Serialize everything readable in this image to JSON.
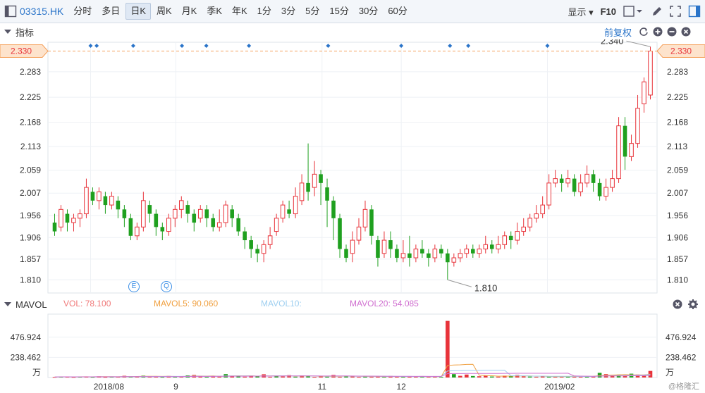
{
  "toolbar": {
    "ticker": "03315.HK",
    "periods": [
      "分时",
      "多日",
      "日K",
      "周K",
      "月K",
      "季K",
      "年K",
      "1分",
      "3分",
      "5分",
      "15分",
      "30分",
      "60分"
    ],
    "active_period": "日K",
    "display_label": "显示",
    "f10_label": "F10"
  },
  "indicator_bar": {
    "title": "指标",
    "adjust_label": "前复权"
  },
  "colors": {
    "up": "#e8333a",
    "down": "#1fa01f",
    "accent": "#2a74c9",
    "price_line": "#f5a05a"
  },
  "price_panel": {
    "current_price_left": "2.330",
    "current_price_right": "2.330",
    "high_label": "2.340",
    "low_label": "1.810",
    "event_icons": [
      "E",
      "Q"
    ]
  },
  "volume_panel": {
    "title": "MAVOL",
    "vol_label": "VOL:",
    "vol_value": "78.100",
    "mavol5_label": "MAVOL5:",
    "mavol5_value": "90.060",
    "mavol10_label": "MAVOL10:",
    "mavol10_value": "",
    "mavol20_label": "MAVOL20:",
    "mavol20_value": "54.085",
    "unit": "万"
  },
  "watermark": "@格隆汇",
  "chart_data": {
    "type": "candlestick",
    "y_ticks": [
      "2.283",
      "2.225",
      "2.168",
      "2.113",
      "2.059",
      "2.007",
      "1.956",
      "1.906",
      "1.857",
      "1.810"
    ],
    "ylim": [
      1.78,
      2.35
    ],
    "x_ticks": [
      "2018/08",
      "9",
      "11",
      "12",
      "2019/02"
    ],
    "volume_ticks": [
      "476.924",
      "238.462"
    ],
    "volume_ylim": [
      0,
      750
    ],
    "candles": [
      [
        1.94,
        1.92,
        1.96,
        1.91
      ],
      [
        1.93,
        1.97,
        1.98,
        1.92
      ],
      [
        1.96,
        1.94,
        1.97,
        1.92
      ],
      [
        1.94,
        1.95,
        1.96,
        1.92
      ],
      [
        1.95,
        1.96,
        1.97,
        1.93
      ],
      [
        1.96,
        2.02,
        2.04,
        1.95
      ],
      [
        2.01,
        1.99,
        2.02,
        1.98
      ],
      [
        1.99,
        2.01,
        2.02,
        1.97
      ],
      [
        2.0,
        1.98,
        2.01,
        1.96
      ],
      [
        1.98,
        2.0,
        2.01,
        1.97
      ],
      [
        1.99,
        1.97,
        2.0,
        1.95
      ],
      [
        1.97,
        1.95,
        1.98,
        1.93
      ],
      [
        1.95,
        1.91,
        1.96,
        1.9
      ],
      [
        1.91,
        1.93,
        1.94,
        1.9
      ],
      [
        1.93,
        1.99,
        2.01,
        1.92
      ],
      [
        1.98,
        1.96,
        1.99,
        1.94
      ],
      [
        1.96,
        1.93,
        1.97,
        1.91
      ],
      [
        1.93,
        1.92,
        1.94,
        1.9
      ],
      [
        1.92,
        1.95,
        1.96,
        1.91
      ],
      [
        1.95,
        1.97,
        1.98,
        1.93
      ],
      [
        1.97,
        1.99,
        2.0,
        1.95
      ],
      [
        1.98,
        1.96,
        1.99,
        1.94
      ],
      [
        1.96,
        1.94,
        1.97,
        1.92
      ],
      [
        1.95,
        1.97,
        1.98,
        1.94
      ],
      [
        1.97,
        1.95,
        1.98,
        1.93
      ],
      [
        1.95,
        1.93,
        1.96,
        1.92
      ],
      [
        1.93,
        1.94,
        1.97,
        1.92
      ],
      [
        1.94,
        1.98,
        1.99,
        1.93
      ],
      [
        1.97,
        1.95,
        1.98,
        1.93
      ],
      [
        1.95,
        1.92,
        1.96,
        1.91
      ],
      [
        1.92,
        1.9,
        1.93,
        1.88
      ],
      [
        1.9,
        1.88,
        1.91,
        1.86
      ],
      [
        1.88,
        1.87,
        1.89,
        1.85
      ],
      [
        1.87,
        1.89,
        1.9,
        1.85
      ],
      [
        1.89,
        1.91,
        1.93,
        1.88
      ],
      [
        1.92,
        1.95,
        1.96,
        1.91
      ],
      [
        1.95,
        1.98,
        1.99,
        1.94
      ],
      [
        1.97,
        1.96,
        1.99,
        1.95
      ],
      [
        1.96,
        2.0,
        2.02,
        1.95
      ],
      [
        1.99,
        2.03,
        2.05,
        1.98
      ],
      [
        2.03,
        2.01,
        2.12,
        1.99
      ],
      [
        2.02,
        2.05,
        2.08,
        2.0
      ],
      [
        2.05,
        2.03,
        2.06,
        1.98
      ],
      [
        2.02,
        1.99,
        2.04,
        1.93
      ],
      [
        1.99,
        1.95,
        2.0,
        1.9
      ],
      [
        1.95,
        1.88,
        1.96,
        1.86
      ],
      [
        1.88,
        1.86,
        1.89,
        1.85
      ],
      [
        1.87,
        1.9,
        1.92,
        1.85
      ],
      [
        1.9,
        1.93,
        1.95,
        1.89
      ],
      [
        1.93,
        1.97,
        1.99,
        1.92
      ],
      [
        1.97,
        1.91,
        1.98,
        1.89
      ],
      [
        1.9,
        1.86,
        1.91,
        1.84
      ],
      [
        1.87,
        1.9,
        1.92,
        1.86
      ],
      [
        1.9,
        1.88,
        1.92,
        1.86
      ],
      [
        1.88,
        1.86,
        1.89,
        1.85
      ],
      [
        1.86,
        1.87,
        1.9,
        1.85
      ],
      [
        1.87,
        1.86,
        1.91,
        1.84
      ],
      [
        1.86,
        1.88,
        1.89,
        1.85
      ],
      [
        1.88,
        1.87,
        1.9,
        1.86
      ],
      [
        1.87,
        1.86,
        1.88,
        1.84
      ],
      [
        1.86,
        1.88,
        1.89,
        1.85
      ],
      [
        1.88,
        1.87,
        1.89,
        1.86
      ],
      [
        1.87,
        1.85,
        1.88,
        1.81
      ],
      [
        1.85,
        1.86,
        1.87,
        1.84
      ],
      [
        1.86,
        1.87,
        1.88,
        1.85
      ],
      [
        1.87,
        1.88,
        1.89,
        1.86
      ],
      [
        1.88,
        1.87,
        1.89,
        1.86
      ],
      [
        1.87,
        1.88,
        1.89,
        1.86
      ],
      [
        1.88,
        1.89,
        1.91,
        1.87
      ],
      [
        1.89,
        1.88,
        1.9,
        1.87
      ],
      [
        1.88,
        1.89,
        1.91,
        1.87
      ],
      [
        1.89,
        1.91,
        1.92,
        1.88
      ],
      [
        1.91,
        1.9,
        1.92,
        1.88
      ],
      [
        1.9,
        1.92,
        1.94,
        1.89
      ],
      [
        1.92,
        1.93,
        1.95,
        1.91
      ],
      [
        1.93,
        1.95,
        1.96,
        1.92
      ],
      [
        1.95,
        1.96,
        1.98,
        1.94
      ],
      [
        1.96,
        1.98,
        2.0,
        1.95
      ],
      [
        1.98,
        2.03,
        2.05,
        1.97
      ],
      [
        2.03,
        2.04,
        2.06,
        2.02
      ],
      [
        2.04,
        2.03,
        2.05,
        2.01
      ],
      [
        2.03,
        2.04,
        2.06,
        2.02
      ],
      [
        2.04,
        2.01,
        2.05,
        2.0
      ],
      [
        2.01,
        2.03,
        2.05,
        2.0
      ],
      [
        2.03,
        2.05,
        2.07,
        2.02
      ],
      [
        2.05,
        2.03,
        2.06,
        2.01
      ],
      [
        2.03,
        2.0,
        2.04,
        1.99
      ],
      [
        2.0,
        2.02,
        2.04,
        1.99
      ],
      [
        2.02,
        2.04,
        2.06,
        2.01
      ],
      [
        2.04,
        2.16,
        2.18,
        2.03
      ],
      [
        2.16,
        2.09,
        2.18,
        2.06
      ],
      [
        2.09,
        2.12,
        2.14,
        2.08
      ],
      [
        2.12,
        2.2,
        2.23,
        2.11
      ],
      [
        2.21,
        2.26,
        2.27,
        2.19
      ],
      [
        2.23,
        2.33,
        2.34,
        2.22
      ]
    ],
    "volumes": [
      [
        6,
        "up"
      ],
      [
        10,
        "down"
      ],
      [
        8,
        "up"
      ],
      [
        5,
        "up"
      ],
      [
        12,
        "down"
      ],
      [
        9,
        "up"
      ],
      [
        7,
        "down"
      ],
      [
        14,
        "up"
      ],
      [
        6,
        "up"
      ],
      [
        11,
        "down"
      ],
      [
        8,
        "up"
      ],
      [
        20,
        "up"
      ],
      [
        9,
        "down"
      ],
      [
        13,
        "up"
      ],
      [
        22,
        "down"
      ],
      [
        10,
        "up"
      ],
      [
        15,
        "up"
      ],
      [
        7,
        "down"
      ],
      [
        18,
        "up"
      ],
      [
        12,
        "down"
      ],
      [
        9,
        "up"
      ],
      [
        25,
        "down"
      ],
      [
        30,
        "up"
      ],
      [
        12,
        "up"
      ],
      [
        8,
        "down"
      ],
      [
        16,
        "up"
      ],
      [
        11,
        "up"
      ],
      [
        40,
        "down"
      ],
      [
        20,
        "up"
      ],
      [
        14,
        "down"
      ],
      [
        10,
        "up"
      ],
      [
        22,
        "up"
      ],
      [
        15,
        "down"
      ],
      [
        38,
        "up"
      ],
      [
        9,
        "up"
      ],
      [
        18,
        "down"
      ],
      [
        12,
        "up"
      ],
      [
        28,
        "up"
      ],
      [
        10,
        "down"
      ],
      [
        24,
        "up"
      ],
      [
        14,
        "down"
      ],
      [
        8,
        "up"
      ],
      [
        17,
        "up"
      ],
      [
        11,
        "down"
      ],
      [
        30,
        "up"
      ],
      [
        9,
        "up"
      ],
      [
        13,
        "down"
      ],
      [
        20,
        "up"
      ],
      [
        7,
        "up"
      ],
      [
        16,
        "down"
      ],
      [
        10,
        "up"
      ],
      [
        12,
        "up"
      ],
      [
        9,
        "down"
      ],
      [
        18,
        "up"
      ],
      [
        8,
        "up"
      ],
      [
        11,
        "down"
      ],
      [
        15,
        "up"
      ],
      [
        10,
        "up"
      ],
      [
        14,
        "down"
      ],
      [
        9,
        "up"
      ],
      [
        12,
        "up"
      ],
      [
        8,
        "down"
      ],
      [
        670,
        "up"
      ],
      [
        40,
        "down"
      ],
      [
        20,
        "up"
      ],
      [
        35,
        "up"
      ],
      [
        18,
        "down"
      ],
      [
        15,
        "up"
      ],
      [
        25,
        "up"
      ],
      [
        12,
        "down"
      ],
      [
        10,
        "up"
      ],
      [
        22,
        "up"
      ],
      [
        16,
        "down"
      ],
      [
        30,
        "up"
      ],
      [
        14,
        "up"
      ],
      [
        11,
        "down"
      ],
      [
        9,
        "up"
      ],
      [
        18,
        "up"
      ],
      [
        12,
        "down"
      ],
      [
        8,
        "up"
      ],
      [
        10,
        "up"
      ],
      [
        15,
        "down"
      ],
      [
        20,
        "up"
      ],
      [
        9,
        "up"
      ],
      [
        12,
        "down"
      ],
      [
        14,
        "up"
      ],
      [
        55,
        "down"
      ],
      [
        40,
        "up"
      ],
      [
        25,
        "up"
      ],
      [
        30,
        "down"
      ],
      [
        20,
        "up"
      ],
      [
        45,
        "down"
      ],
      [
        35,
        "up"
      ],
      [
        28,
        "up"
      ],
      [
        78,
        "up"
      ]
    ]
  }
}
